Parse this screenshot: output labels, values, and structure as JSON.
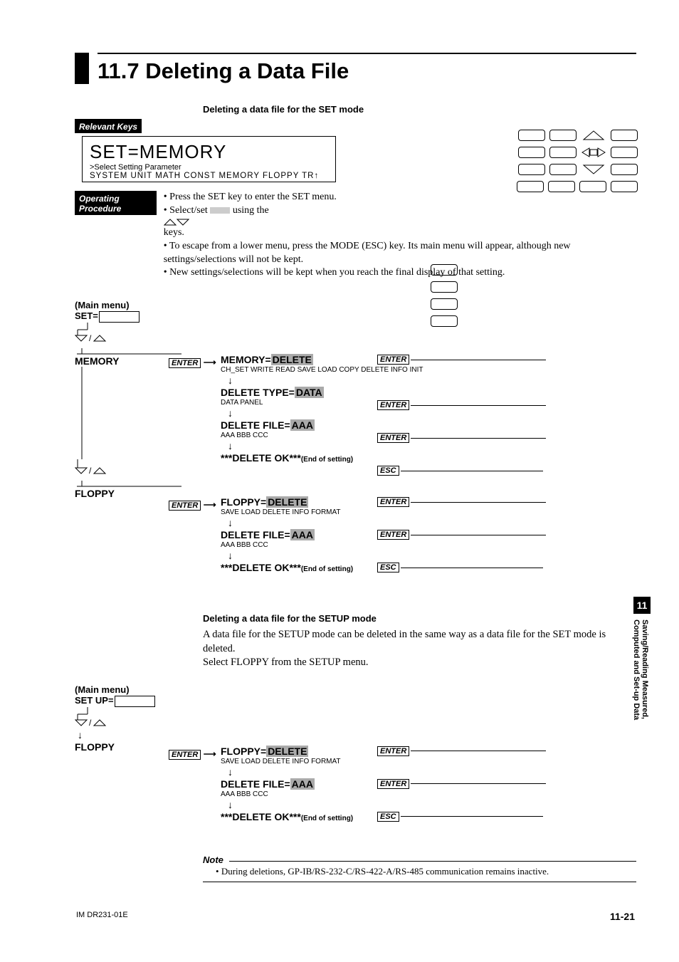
{
  "heading": "11.7 Deleting a Data File",
  "sub1": "Deleting a data file for the SET mode",
  "relevant_keys": "Relevant Keys",
  "lcd": {
    "big": "SET=MEMORY",
    "select": ">Select Setting Parameter",
    "opts": "SYSTEM  UNIT  MATH  CONST  MEMORY  FLOPPY  TR↑"
  },
  "op_procedure": "Operating Procedure",
  "bullets": [
    "Press the SET key to enter the SET menu.",
    "Select/set        using the           keys.",
    "To escape from a lower menu, press the MODE (ESC) key.  Its main menu will appear, although new settings/selections will not be kept.",
    "New settings/selections will be kept when you reach the final display of that setting."
  ],
  "main_menu": "(Main menu)",
  "set_eq": "SET=",
  "setup_eq": "SET UP=",
  "enter": "ENTER",
  "esc": "ESC",
  "mem": {
    "h": "MEMORY",
    "r1a": "MEMORY=",
    "r1b": "DELETE",
    "r1s": "CH_SET WRITE READ SAVE LOAD COPY DELETE INFO INIT",
    "r2a": "DELETE TYPE=",
    "r2b": "DATA",
    "r2s": "DATA PANEL",
    "r3a": "DELETE FILE=",
    "r3b": "AAA",
    "r3s": "AAA  BBB  CCC",
    "r4": "***DELETE OK***",
    "r4e": "(End of setting)"
  },
  "flop": {
    "h": "FLOPPY",
    "r1a": "FLOPPY=",
    "r1b": "DELETE",
    "r1s": "SAVE LOAD DELETE INFO FORMAT",
    "r2a": "DELETE FILE=",
    "r2b": "AAA",
    "r2s": "AAA  BBB  CCC",
    "r3": "***DELETE OK***",
    "r3e": "(End of setting)"
  },
  "setup_head": "Deleting a data file for the SETUP mode",
  "setup_body1": "A data file for the SETUP mode can be deleted in the same way as a data file for the SET mode is deleted.",
  "setup_body2": "Select FLOPPY from the SETUP menu.",
  "note_head": "Note",
  "note_body": "During deletions, GP-IB/RS-232-C/RS-422-A/RS-485 communication remains inactive.",
  "sidetab": "11",
  "sidetext1": "Saving/Reading Measured,",
  "sidetext2": "Computed and Set-up Data",
  "footer_left": "IM DR231-01E",
  "footer_right": "11-21"
}
